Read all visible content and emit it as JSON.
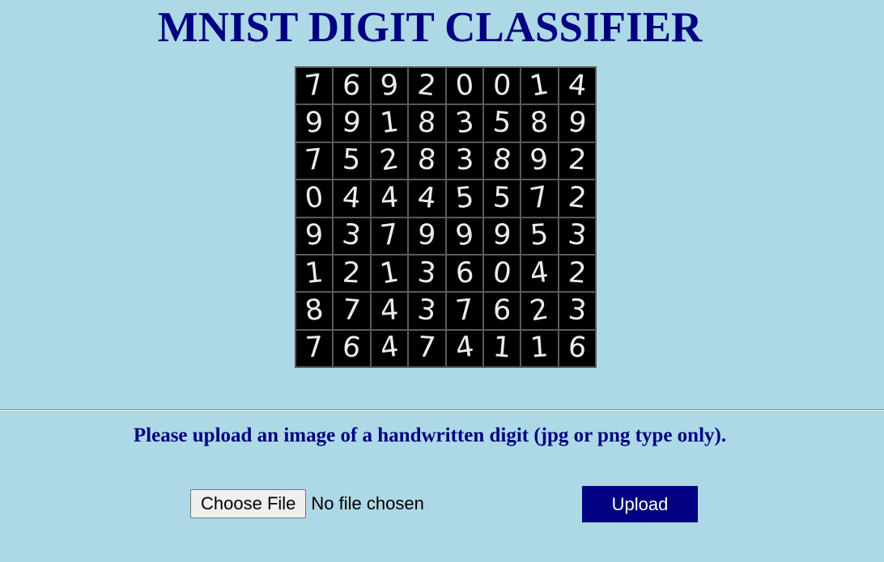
{
  "header": {
    "title": "MNIST DIGIT CLASSIFIER"
  },
  "sample_grid": {
    "rows": [
      [
        "7",
        "6",
        "9",
        "2",
        "0",
        "0",
        "1",
        "4"
      ],
      [
        "9",
        "9",
        "1",
        "8",
        "3",
        "5",
        "8",
        "9"
      ],
      [
        "7",
        "5",
        "2",
        "8",
        "3",
        "8",
        "9",
        "2"
      ],
      [
        "0",
        "4",
        "4",
        "4",
        "5",
        "5",
        "7",
        "2"
      ],
      [
        "9",
        "3",
        "7",
        "9",
        "9",
        "9",
        "5",
        "3"
      ],
      [
        "1",
        "2",
        "1",
        "3",
        "6",
        "0",
        "4",
        "2"
      ],
      [
        "8",
        "7",
        "4",
        "3",
        "7",
        "6",
        "2",
        "3"
      ],
      [
        "7",
        "6",
        "4",
        "7",
        "4",
        "1",
        "1",
        "6"
      ]
    ]
  },
  "upload_form": {
    "instructions": "Please upload an image of a handwritten digit (jpg or png type only).",
    "choose_file_label": "Choose File",
    "file_status": "No file chosen",
    "upload_label": "Upload"
  },
  "colors": {
    "background": "#add8e6",
    "heading": "#000080",
    "upload_button": "#000080"
  }
}
